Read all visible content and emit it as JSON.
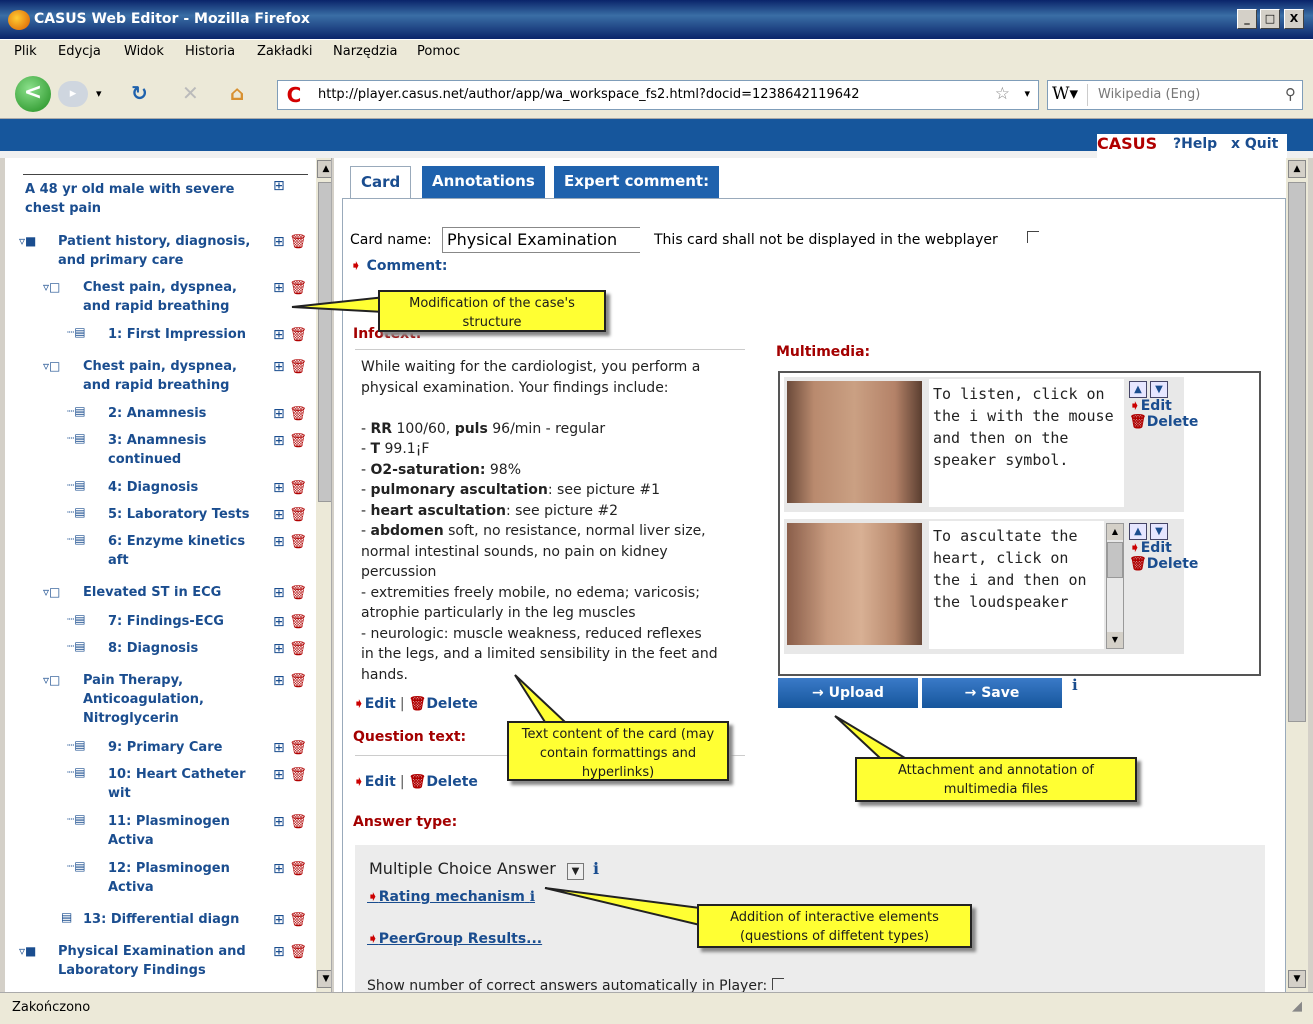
{
  "window": {
    "title": "CASUS Web Editor - Mozilla Firefox",
    "minimize": "_",
    "maximize": "□",
    "close": "X"
  },
  "menu": [
    "Plik",
    "Edycja",
    "Widok",
    "Historia",
    "Zakładki",
    "Narzędzia",
    "Pomoc"
  ],
  "navbar": {
    "url": "http://player.casus.net/author/app/wa_workspace_fs2.html?docid=1238642119642",
    "search_placeholder": "Wikipedia (Eng)"
  },
  "brand": {
    "name": "CASUS",
    "help": "?Help",
    "quit": "x Quit"
  },
  "tree": {
    "root": "A 48 yr old male with severe chest pain",
    "items": [
      {
        "label": "Patient history, diagnosis, and primary care",
        "level": 0,
        "type": "folder"
      },
      {
        "label": "Chest pain, dyspnea, and rapid breathing",
        "level": 1,
        "type": "folder"
      },
      {
        "label": "1: First Impression",
        "level": 2,
        "type": "card"
      },
      {
        "label": "Chest pain, dyspnea, and rapid breathing",
        "level": 1,
        "type": "folder"
      },
      {
        "label": "2: Anamnesis",
        "level": 2,
        "type": "card"
      },
      {
        "label": "3: Anamnesis continued",
        "level": 2,
        "type": "card"
      },
      {
        "label": "4: Diagnosis",
        "level": 2,
        "type": "card"
      },
      {
        "label": "5: Laboratory Tests",
        "level": 2,
        "type": "card"
      },
      {
        "label": "6: Enzyme kinetics aft",
        "level": 2,
        "type": "card"
      },
      {
        "label": "Elevated ST in ECG",
        "level": 1,
        "type": "folder"
      },
      {
        "label": "7: Findings-ECG",
        "level": 2,
        "type": "card"
      },
      {
        "label": "8: Diagnosis",
        "level": 2,
        "type": "card"
      },
      {
        "label": "Pain Therapy, Anticoagulation, Nitroglycerin",
        "level": 1,
        "type": "folder"
      },
      {
        "label": "9: Primary Care",
        "level": 2,
        "type": "card"
      },
      {
        "label": "10: Heart Catheter wit",
        "level": 2,
        "type": "card"
      },
      {
        "label": "11: Plasminogen Activa",
        "level": 2,
        "type": "card"
      },
      {
        "label": "12: Plasminogen Activa",
        "level": 2,
        "type": "card"
      },
      {
        "label": "13: Differential diagn",
        "level": 1,
        "type": "card"
      },
      {
        "label": "Physical Examination and Laboratory Findings",
        "level": 0,
        "type": "folder"
      }
    ]
  },
  "tabs": [
    "Card",
    "Annotations",
    "Expert comment:"
  ],
  "card": {
    "name_label": "Card name:",
    "name_value": "Physical Examination",
    "hidden_label": "This card shall not be displayed in the webplayer",
    "comment_label": "Comment:",
    "infotext_label": "Infotext:",
    "infotext_lines": [
      "While waiting for the cardiologist, you perform a",
      "physical examination. Your findings include:",
      "",
      "- RR 100/60, puls 96/min - regular",
      "- T 99.1¡F",
      "- O2-saturation: 98%",
      "- pulmonary ascultation: see picture #1",
      "- heart ascultation: see picture #2",
      "- abdomen soft, no resistance, normal liver size,",
      "normal intestinal sounds, no pain on kidney",
      "percussion",
      "- extremities freely mobile, no edema; varicosis;",
      "atrophie particularly in the leg muscles",
      "- neurologic: muscle weakness, reduced reflexes",
      "in the legs, and a limited sensibility in the feet and",
      "hands."
    ],
    "edit": "Edit",
    "delete": "Delete",
    "question_label": "Question text:",
    "answer_type_label": "Answer type:",
    "answer_type_value": "Multiple Choice Answer",
    "rating_link": "Rating mechanism",
    "peergroup_link": "PeerGroup Results...",
    "show_correct_label": "Show number of correct answers automatically in Player:"
  },
  "multimedia": {
    "label": "Multimedia:",
    "items": [
      {
        "text": "To listen, click on the i with the mouse and then on the speaker symbol."
      },
      {
        "text": "To ascultate the heart, click on the i and then on the loudspeaker"
      }
    ],
    "edit": "Edit",
    "delete": "Delete",
    "upload": "→ Upload",
    "save": "→ Save"
  },
  "callouts": {
    "structure": "Modification of the case's structure",
    "text_content": "Text content of the card (may contain formattings and hyperlinks)",
    "attachment": "Attachment and annotation of multimedia files",
    "interactive": "Addition of interactive elements (questions of diffetent types)"
  },
  "status": "Zakończono",
  "colors": {
    "accent": "#1f62ad",
    "brand_red": "#a30000",
    "callout": "#ffff33"
  }
}
